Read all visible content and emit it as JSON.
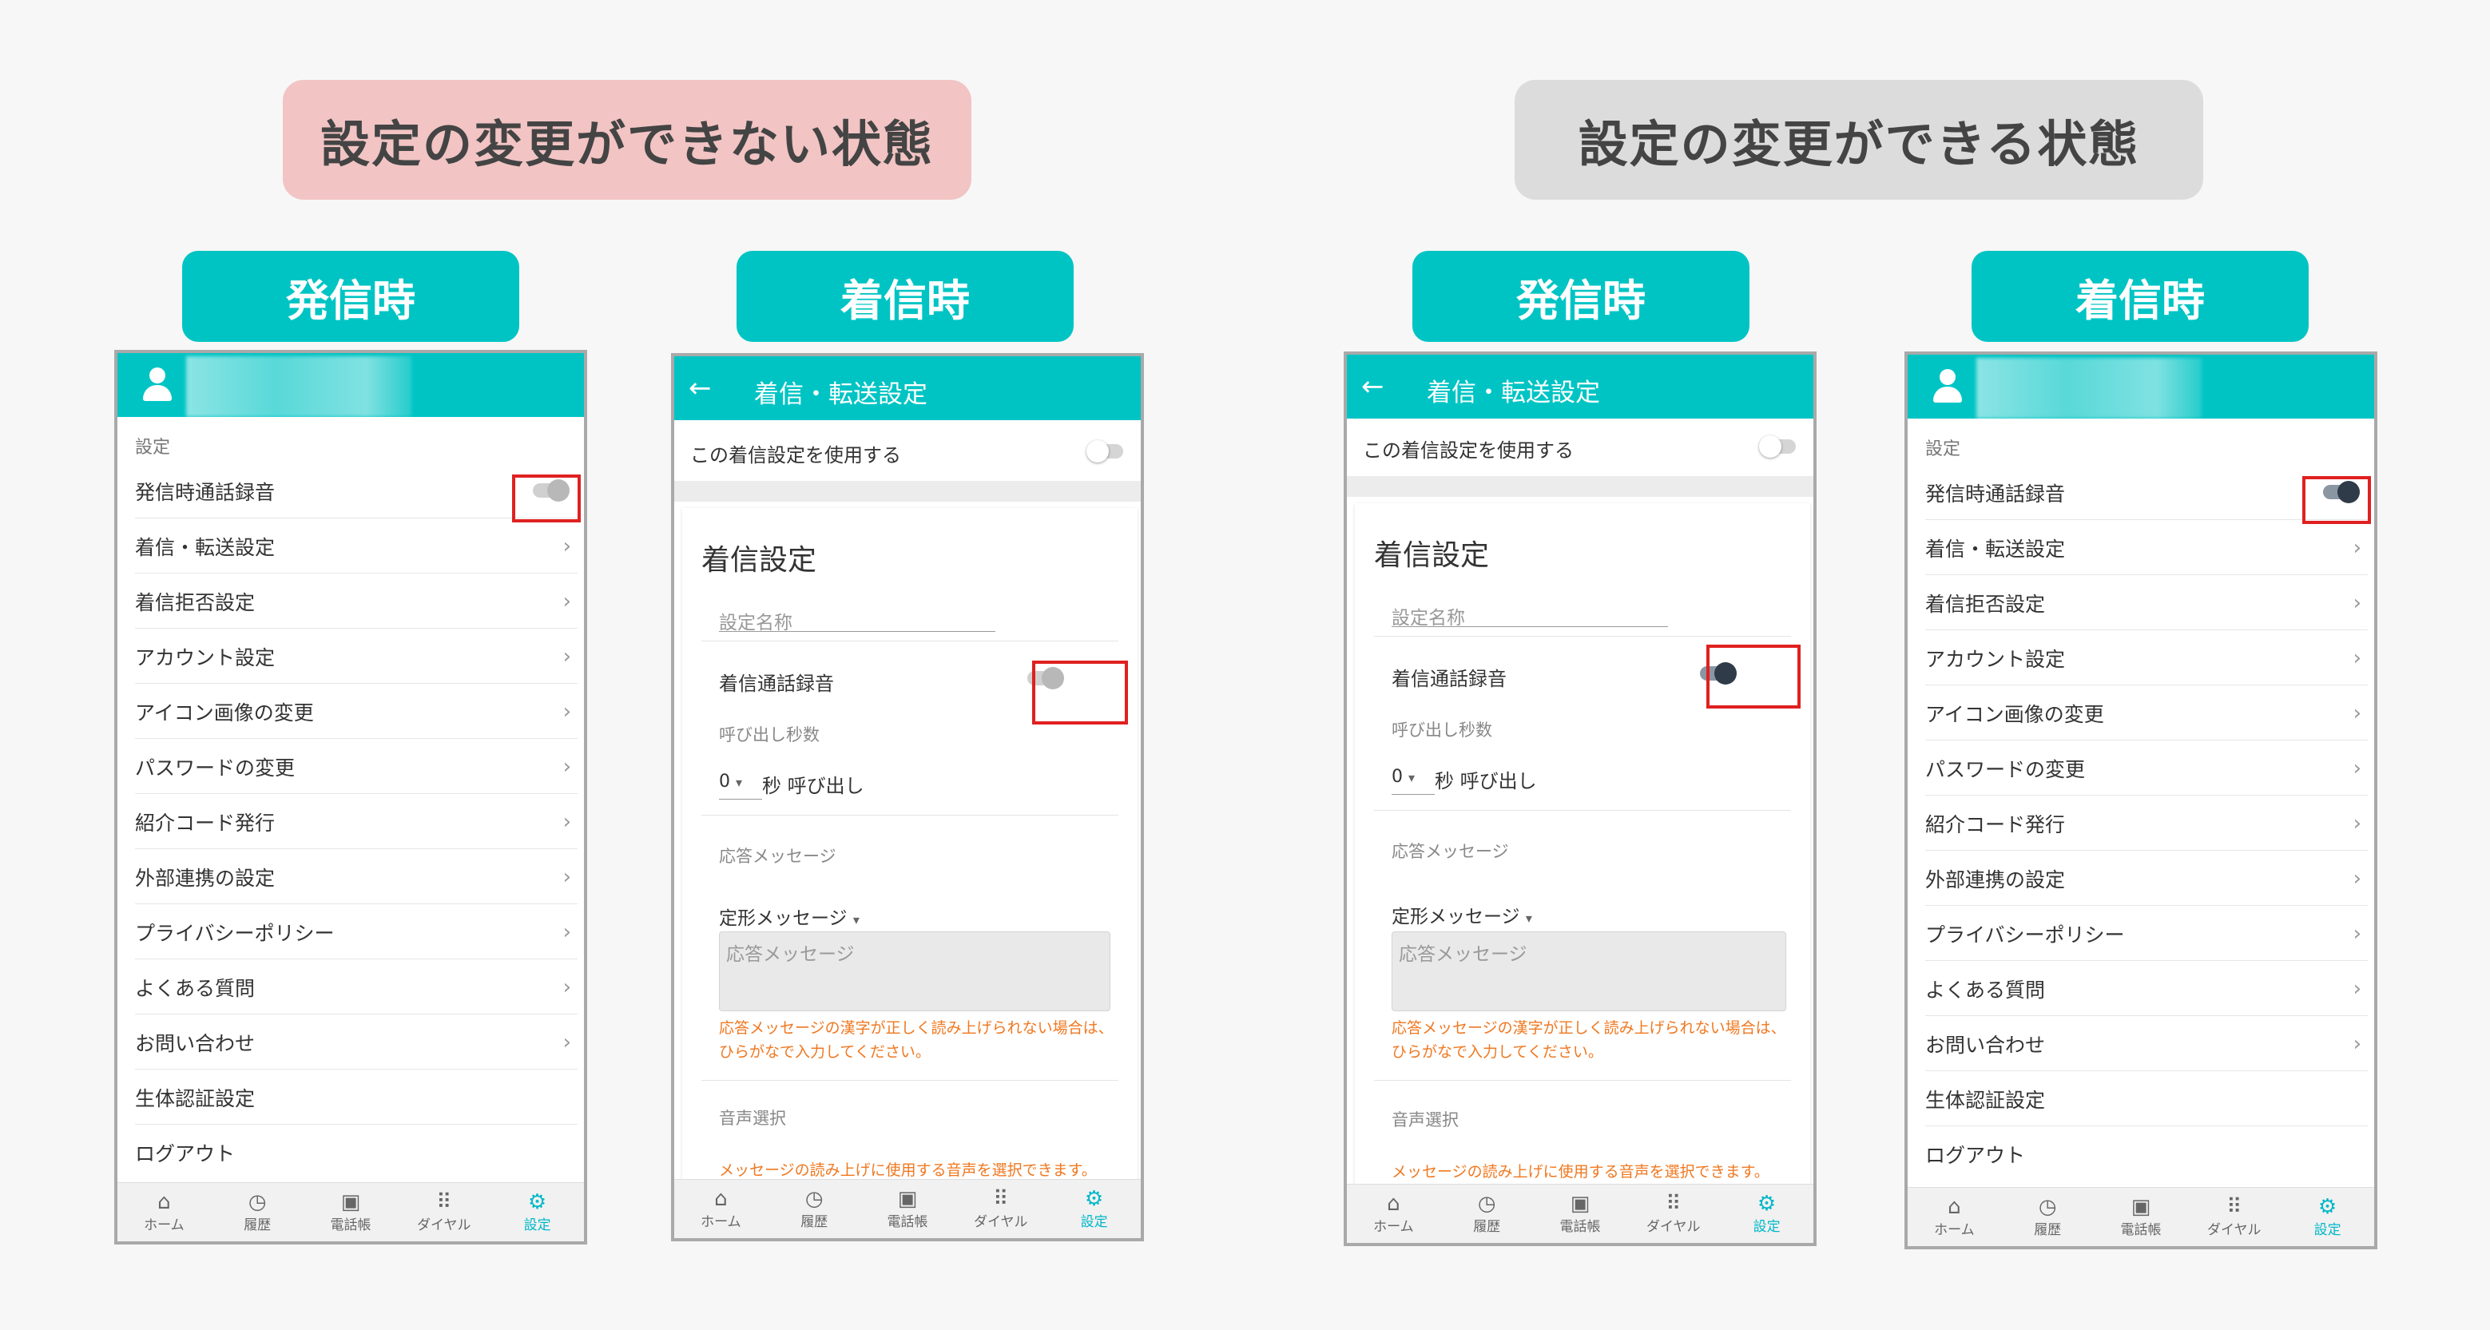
{
  "banners": {
    "left": "設定の変更ができない状態",
    "right": "設定の変更ができる状態"
  },
  "captions": {
    "outgoing": "発信時",
    "incoming": "着信時"
  },
  "settings_screen": {
    "section_label": "設定",
    "items": [
      {
        "label": "発信時通話録音",
        "chevron": false,
        "toggle": true
      },
      {
        "label": "着信・転送設定",
        "chevron": true
      },
      {
        "label": "着信拒否設定",
        "chevron": true
      },
      {
        "label": "アカウント設定",
        "chevron": true
      },
      {
        "label": "アイコン画像の変更",
        "chevron": true
      },
      {
        "label": "パスワードの変更",
        "chevron": true
      },
      {
        "label": "紹介コード発行",
        "chevron": true
      },
      {
        "label": "外部連携の設定",
        "chevron": true
      },
      {
        "label": "プライバシーポリシー",
        "chevron": true
      },
      {
        "label": "よくある質問",
        "chevron": true
      },
      {
        "label": "お問い合わせ",
        "chevron": true
      },
      {
        "label": "生体認証設定",
        "chevron": false
      },
      {
        "label": "ログアウト",
        "chevron": false
      }
    ]
  },
  "incoming_screen": {
    "back_icon": "arrow-left-icon",
    "header_title": "着信・転送設定",
    "use_setting_label": "この着信設定を使用する",
    "card_title": "着信設定",
    "setting_name_placeholder": "設定名称",
    "record_label": "着信通話録音",
    "ring_seconds_label": "呼び出し秒数",
    "ring_value": "0",
    "ring_suffix": "秒 呼び出し",
    "response_label": "応答メッセージ",
    "fixed_message_label": "定形メッセージ",
    "textarea_placeholder": "応答メッセージ",
    "warning_kanji": "応答メッセージの漢字が正しく読み上げられない場合は、ひらがなで入力してください。",
    "voice_label": "音声選択",
    "warning_voice": "メッセージの読み上げに使用する音声を選択できます。"
  },
  "nav": [
    {
      "label": "ホーム",
      "icon": "home-icon"
    },
    {
      "label": "履歴",
      "icon": "clock-icon"
    },
    {
      "label": "電話帳",
      "icon": "contacts-icon"
    },
    {
      "label": "ダイヤル",
      "icon": "dialpad-icon"
    },
    {
      "label": "設定",
      "icon": "gear-icon"
    }
  ],
  "toggle_states": {
    "left_outgoing": "disabled",
    "left_incoming": "disabled",
    "right_incoming": "enabled",
    "right_outgoing": "enabled"
  },
  "colors": {
    "accent": "#00c4c4",
    "banner_disabled": "#f2c4c4",
    "banner_enabled": "#dcdcdc",
    "highlight": "#e02020",
    "warning": "#f07820"
  }
}
